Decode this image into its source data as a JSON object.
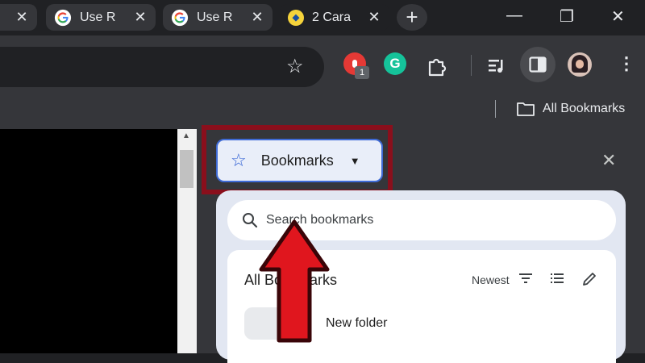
{
  "tabs": [
    {
      "title": "",
      "favicon": "tab-fragment"
    },
    {
      "title": "Use R",
      "favicon": "google-logo"
    },
    {
      "title": "Use R",
      "favicon": "google-logo"
    },
    {
      "title": "2 Cara",
      "favicon": "yellow-circle-logo"
    }
  ],
  "tab_close_glyph": "✕",
  "new_tab_glyph": "+",
  "extension_badge": "1",
  "grammarly_letter": "G",
  "bookmarks_bar": {
    "all_bookmarks_label": "All Bookmarks"
  },
  "side_panel": {
    "dropdown_label": "Bookmarks",
    "search_placeholder": "Search bookmarks",
    "section_title": "All Bookmarks",
    "sort_label": "Newest",
    "new_folder_label": "New folder"
  },
  "colors": {
    "highlight_box": "#8a0f1c",
    "arrow": "#e0161e",
    "accent": "#3f6bd6"
  }
}
